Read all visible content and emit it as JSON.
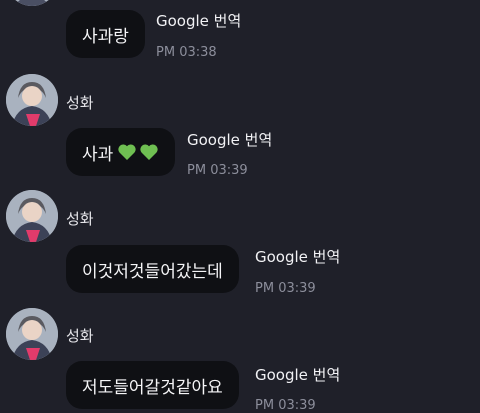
{
  "colors": {
    "background": "#1f2029",
    "bubble": "#0f1014",
    "timestamp": "#8c8e9b",
    "heart": "#6fbf52"
  },
  "messages": [
    {
      "sender": "",
      "text": "사과랑",
      "emoji": [],
      "translate_label": "Google 번역",
      "time": "PM 03:38"
    },
    {
      "sender": "성화",
      "text": "사과",
      "emoji": [
        "green-heart-icon",
        "green-heart-icon"
      ],
      "translate_label": "Google 번역",
      "time": "PM 03:39"
    },
    {
      "sender": "성화",
      "text": "이것저것들어갔는데",
      "emoji": [],
      "translate_label": "Google 번역",
      "time": "PM 03:39"
    },
    {
      "sender": "성화",
      "text": "저도들어갈것같아요",
      "emoji": [],
      "translate_label": "Google 번역",
      "time": "PM 03:39"
    }
  ]
}
